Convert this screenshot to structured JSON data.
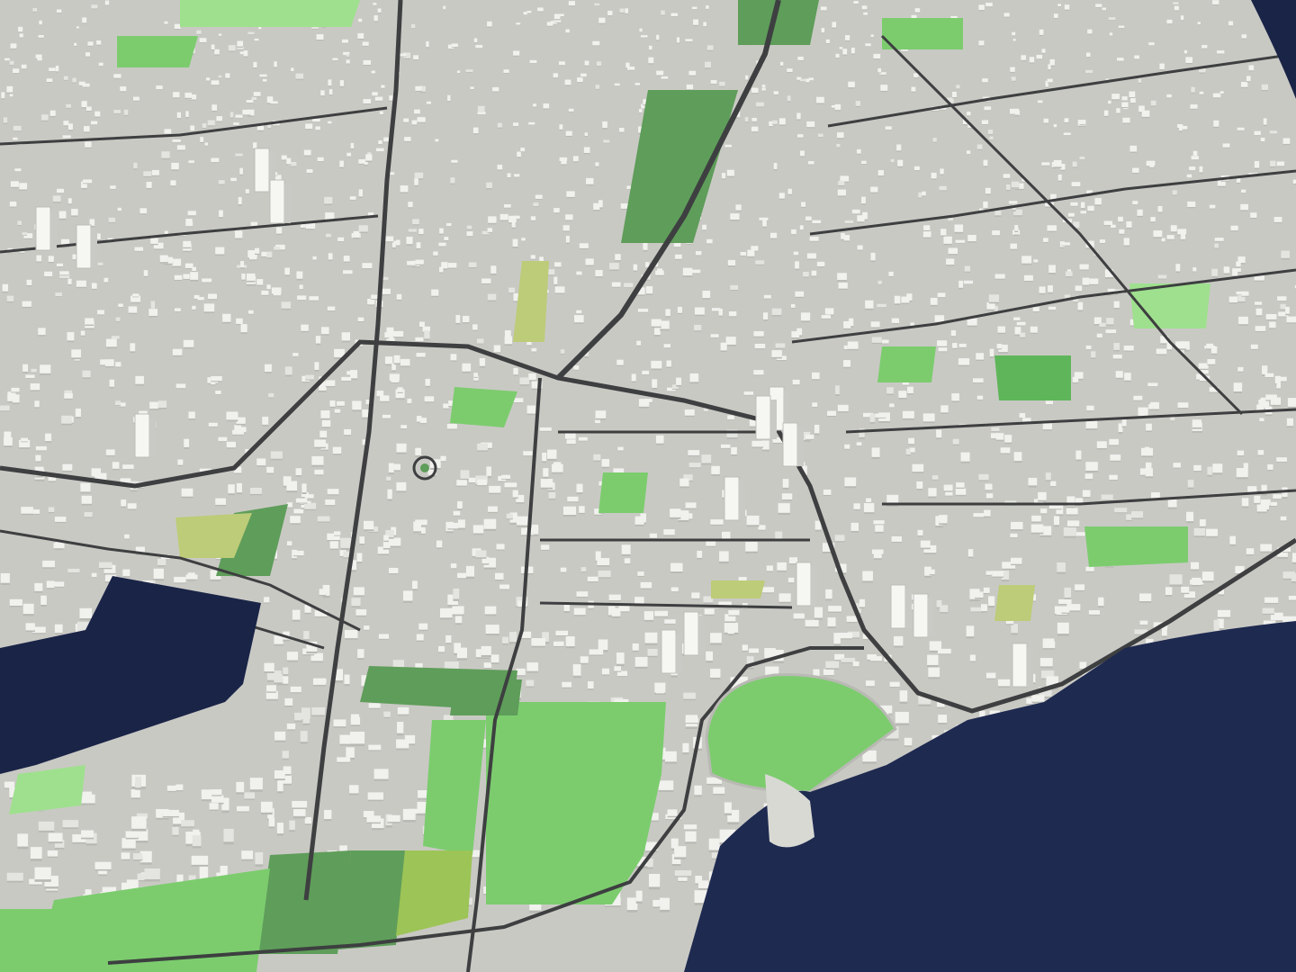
{
  "scene": {
    "kind": "3d-city-map-render",
    "style": "white massing buildings on grey ground with green parks and dark blue water",
    "labels_visible": false
  },
  "colors": {
    "ground": "#c9c9c4",
    "road": "#3d3f40",
    "building_top": "#f1f1ee",
    "building_shadow": "#b9b9b4",
    "park": "#7ccc6e",
    "park_light": "#9fe08e",
    "park_dark": "#5f9d5a",
    "park_yellow": "#bccc78",
    "water": "#1a2447",
    "pier": "#d9d9d4"
  },
  "features": {
    "water_bodies": [
      "harbor-basin",
      "sea"
    ],
    "parks_large": [
      "waterfront-green",
      "stadium-field",
      "central-green-strip",
      "sports-ground"
    ],
    "roundabout": true,
    "rail_corridor": true
  }
}
